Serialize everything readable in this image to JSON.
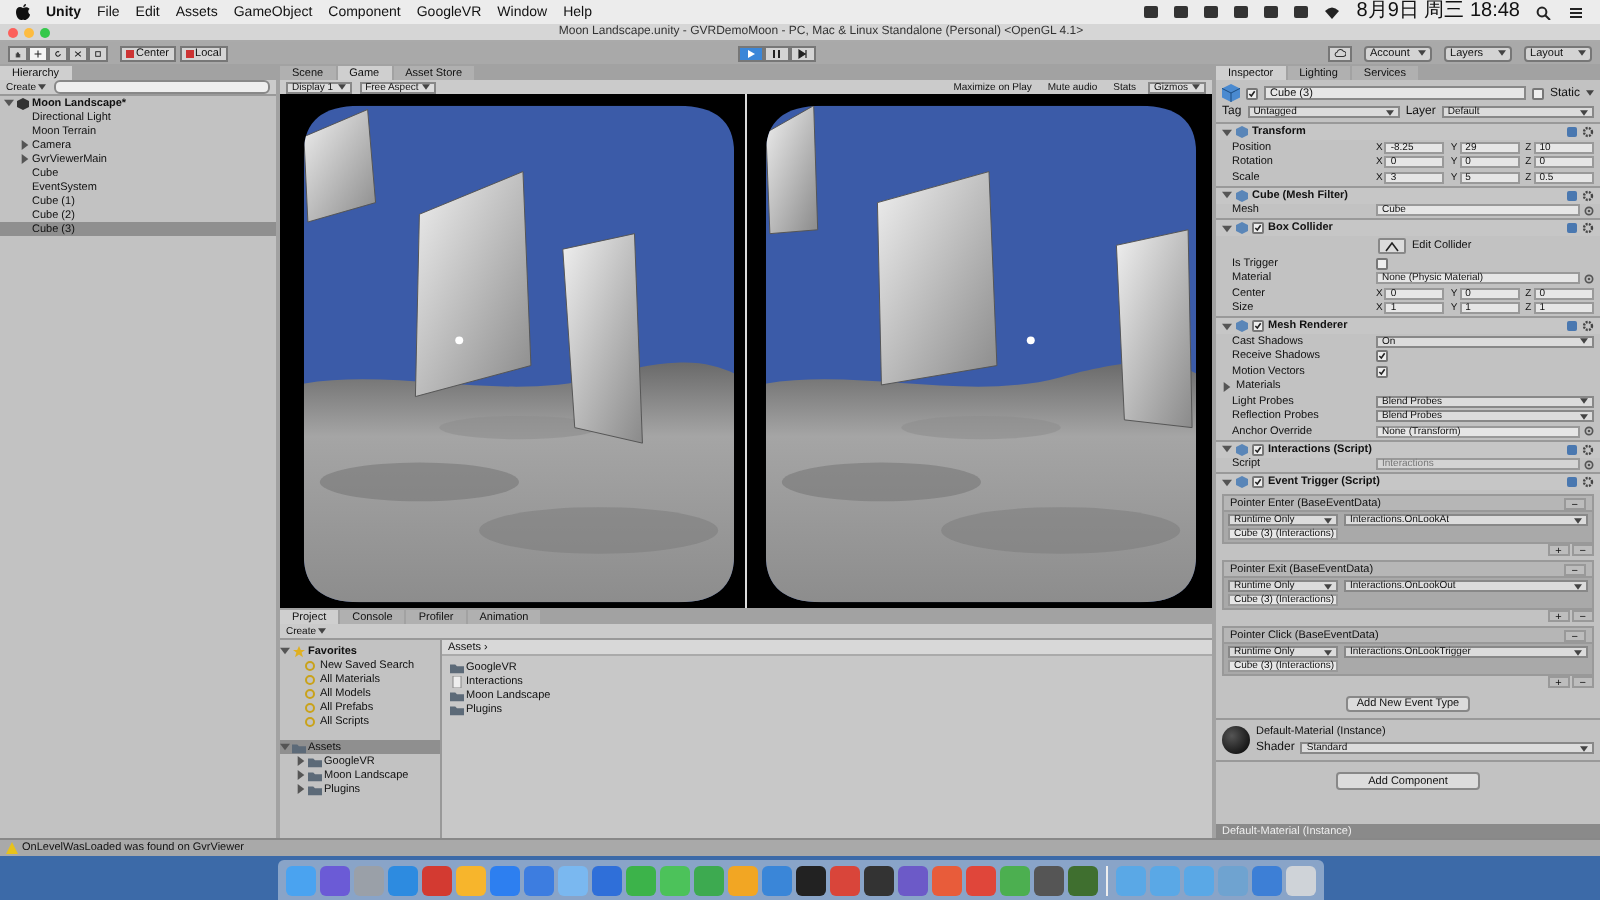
{
  "menubar": {
    "app": "Unity",
    "items": [
      "File",
      "Edit",
      "Assets",
      "GameObject",
      "Component",
      "GoogleVR",
      "Window",
      "Help"
    ],
    "clock": "8月9日 周三 18:48"
  },
  "window": {
    "title": "Moon Landscape.unity - GVRDemoMoon - PC, Mac & Linux Standalone (Personal) <OpenGL 4.1>"
  },
  "toolbar": {
    "tools": [
      {
        "kind": "hand",
        "selected": false
      },
      {
        "kind": "move",
        "selected": true
      },
      {
        "kind": "rotate",
        "selected": false
      },
      {
        "kind": "scale",
        "selected": false
      },
      {
        "kind": "rect",
        "selected": false
      }
    ],
    "pivot": [
      "Center",
      "Local"
    ],
    "play_controls": [
      {
        "kind": "play",
        "on": true
      },
      {
        "kind": "pause",
        "on": false
      },
      {
        "kind": "step",
        "on": false
      }
    ],
    "menus": [
      "Account",
      "Layers",
      "Layout"
    ]
  },
  "hierarchy": {
    "tab": "Hierarchy",
    "create": "Create",
    "tree": [
      {
        "label": "Moon Landscape*",
        "selected": false,
        "expanded": true,
        "children": [
          {
            "label": "Directional Light",
            "selected": false
          },
          {
            "label": "Moon Terrain",
            "selected": false
          },
          {
            "label": "Camera",
            "selected": false,
            "expanded": false
          },
          {
            "label": "GvrViewerMain",
            "selected": false,
            "expanded": false
          },
          {
            "label": "Cube",
            "selected": false
          },
          {
            "label": "EventSystem",
            "selected": false
          },
          {
            "label": "Cube (1)",
            "selected": false
          },
          {
            "label": "Cube (2)",
            "selected": false
          },
          {
            "label": "Cube (3)",
            "selected": true
          }
        ]
      }
    ]
  },
  "view_tabs": [
    {
      "label": "Scene",
      "selected": false
    },
    {
      "label": "Game",
      "selected": true
    },
    {
      "label": "Asset Store",
      "selected": false
    }
  ],
  "game_toolbar": {
    "left": [
      "Display 1",
      "Free Aspect"
    ],
    "toggles": [
      "Maximize on Play",
      "Mute audio",
      "Stats"
    ],
    "gizmos": "Gizmos"
  },
  "project": {
    "tabs": [
      {
        "label": "Project",
        "selected": true
      },
      {
        "label": "Console",
        "selected": false
      },
      {
        "label": "Profiler",
        "selected": false
      },
      {
        "label": "Animation",
        "selected": false
      }
    ],
    "create": "Create",
    "favorites": {
      "label": "Favorites",
      "expanded": true,
      "items": [
        {
          "label": "New Saved Search",
          "selected": false
        },
        {
          "label": "All Materials",
          "selected": false
        },
        {
          "label": "All Models",
          "selected": false
        },
        {
          "label": "All Prefabs",
          "selected": false
        },
        {
          "label": "All Scripts",
          "selected": false
        }
      ]
    },
    "folders": {
      "label": "Assets",
      "selected": true,
      "expanded": true,
      "children": [
        {
          "label": "GoogleVR",
          "selected": false,
          "expanded": false
        },
        {
          "label": "Moon Landscape",
          "selected": false,
          "expanded": false
        },
        {
          "label": "Plugins",
          "selected": false,
          "expanded": false
        }
      ]
    },
    "breadcrumb": "Assets ›",
    "assets": [
      {
        "kind": "folder",
        "label": "GoogleVR"
      },
      {
        "kind": "script",
        "label": "Interactions"
      },
      {
        "kind": "folder",
        "label": "Moon Landscape"
      },
      {
        "kind": "folder",
        "label": "Plugins"
      }
    ]
  },
  "inspector": {
    "tabs": [
      {
        "label": "Inspector",
        "selected": true
      },
      {
        "label": "Lighting",
        "selected": false
      },
      {
        "label": "Services",
        "selected": false
      }
    ],
    "object": {
      "active": true,
      "name": "Cube (3)",
      "static_label": "Static",
      "static": false,
      "tag_label": "Tag",
      "tag": "Untagged",
      "layer_label": "Layer",
      "layer": "Default"
    },
    "components": [
      {
        "kind": "component",
        "title": "Transform",
        "expanded": true,
        "rows": [
          {
            "kind": "vector3",
            "label": "Position",
            "fields": [
              {
                "axis": "X",
                "value": "-8.25"
              },
              {
                "axis": "Y",
                "value": "29"
              },
              {
                "axis": "Z",
                "value": "10"
              }
            ]
          },
          {
            "kind": "vector3",
            "label": "Rotation",
            "fields": [
              {
                "axis": "X",
                "value": "0"
              },
              {
                "axis": "Y",
                "value": "0"
              },
              {
                "axis": "Z",
                "value": "0"
              }
            ]
          },
          {
            "kind": "vector3",
            "label": "Scale",
            "fields": [
              {
                "axis": "X",
                "value": "3"
              },
              {
                "axis": "Y",
                "value": "5"
              },
              {
                "axis": "Z",
                "value": "0.5"
              }
            ]
          }
        ]
      },
      {
        "kind": "component",
        "title": "Cube (Mesh Filter)",
        "expanded": true,
        "rows": [
          {
            "kind": "object",
            "label": "Mesh",
            "value": "Cube"
          }
        ]
      },
      {
        "kind": "component",
        "title": "Box Collider",
        "enabled": true,
        "expanded": true,
        "rows": [
          {
            "kind": "edit",
            "label": "Edit Collider"
          },
          {
            "kind": "checkbox",
            "label": "Is Trigger",
            "checked": false
          },
          {
            "kind": "object",
            "label": "Material",
            "value": "None (Physic Material)"
          },
          {
            "kind": "vector3",
            "label": "Center",
            "fields": [
              {
                "axis": "X",
                "value": "0"
              },
              {
                "axis": "Y",
                "value": "0"
              },
              {
                "axis": "Z",
                "value": "0"
              }
            ]
          },
          {
            "kind": "vector3",
            "label": "Size",
            "fields": [
              {
                "axis": "X",
                "value": "1"
              },
              {
                "axis": "Y",
                "value": "1"
              },
              {
                "axis": "Z",
                "value": "1"
              }
            ]
          }
        ]
      },
      {
        "kind": "component",
        "title": "Mesh Renderer",
        "enabled": true,
        "expanded": true,
        "rows": [
          {
            "kind": "dropdown",
            "label": "Cast Shadows",
            "value": "On"
          },
          {
            "kind": "checkbox",
            "label": "Receive Shadows",
            "checked": true
          },
          {
            "kind": "checkbox",
            "label": "Motion Vectors",
            "checked": true
          },
          {
            "kind": "foldout",
            "label": "Materials",
            "expanded": false
          },
          {
            "kind": "dropdown",
            "label": "Light Probes",
            "value": "Blend Probes"
          },
          {
            "kind": "dropdown",
            "label": "Reflection Probes",
            "value": "Blend Probes"
          },
          {
            "kind": "object",
            "label": "Anchor Override",
            "value": "None (Transform)"
          }
        ]
      },
      {
        "kind": "component",
        "title": "Interactions (Script)",
        "enabled": true,
        "expanded": true,
        "rows": [
          {
            "kind": "object",
            "label": "Script",
            "value": "Interactions",
            "disabled": true
          }
        ]
      },
      {
        "kind": "component",
        "title": "Event Trigger (Script)",
        "enabled": true,
        "expanded": true,
        "rows": [
          {
            "kind": "event",
            "title": "Pointer Enter (BaseEventData)",
            "remove": "−",
            "mode": "Runtime Only",
            "function": "Interactions.OnLookAt",
            "target": "Cube (3) (Interactions)",
            "list_buttons": [
              "+",
              "−"
            ]
          },
          {
            "kind": "event",
            "title": "Pointer Exit (BaseEventData)",
            "remove": "−",
            "mode": "Runtime Only",
            "function": "Interactions.OnLookOut",
            "target": "Cube (3) (Interactions)",
            "list_buttons": [
              "+",
              "−"
            ]
          },
          {
            "kind": "event",
            "title": "Pointer Click (BaseEventData)",
            "remove": "−",
            "mode": "Runtime Only",
            "function": "Interactions.OnLookTrigger",
            "target": "Cube (3) (Interactions)",
            "list_buttons": [
              "+",
              "−"
            ]
          },
          {
            "kind": "wide_button",
            "label": "Add New Event Type"
          }
        ]
      },
      {
        "kind": "material",
        "title": "Default-Material (Instance)",
        "shader_label": "Shader",
        "shader": "Standard"
      }
    ],
    "add_component": "Add Component",
    "preview_bar": "Default-Material (Instance)"
  },
  "status_bar": {
    "message": "OnLevelWasLoaded was found on GvrViewer"
  },
  "dock": {
    "apps": [
      {
        "color": "#4aa3f0"
      },
      {
        "color": "#6b5bd6"
      },
      {
        "color": "#9aa0a8"
      },
      {
        "color": "#2d8be0"
      },
      {
        "color": "#d33a31"
      },
      {
        "color": "#f7b52c"
      },
      {
        "color": "#2d7ff0"
      },
      {
        "color": "#3d7de0"
      },
      {
        "color": "#7ab8f0"
      },
      {
        "color": "#2f6fd9"
      },
      {
        "color": "#3cb34a"
      },
      {
        "color": "#4cc25a"
      },
      {
        "color": "#3daa50"
      },
      {
        "color": "#f2a623"
      },
      {
        "color": "#3a86d8"
      },
      {
        "color": "#222222"
      },
      {
        "color": "#d9453a"
      },
      {
        "color": "#333333"
      },
      {
        "color": "#6c5ac8"
      },
      {
        "color": "#e85c3a"
      },
      {
        "color": "#e0463a"
      },
      {
        "color": "#4caf50"
      },
      {
        "color": "#555555"
      },
      {
        "color": "#3f6f2f"
      }
    ],
    "docs": [
      {
        "color": "#5aa8e6"
      },
      {
        "color": "#5aa8e6"
      },
      {
        "color": "#5aa8e6"
      },
      {
        "color": "#6fa3d0"
      },
      {
        "color": "#3d7fd6"
      },
      {
        "color": "#cfd3d8"
      }
    ]
  }
}
